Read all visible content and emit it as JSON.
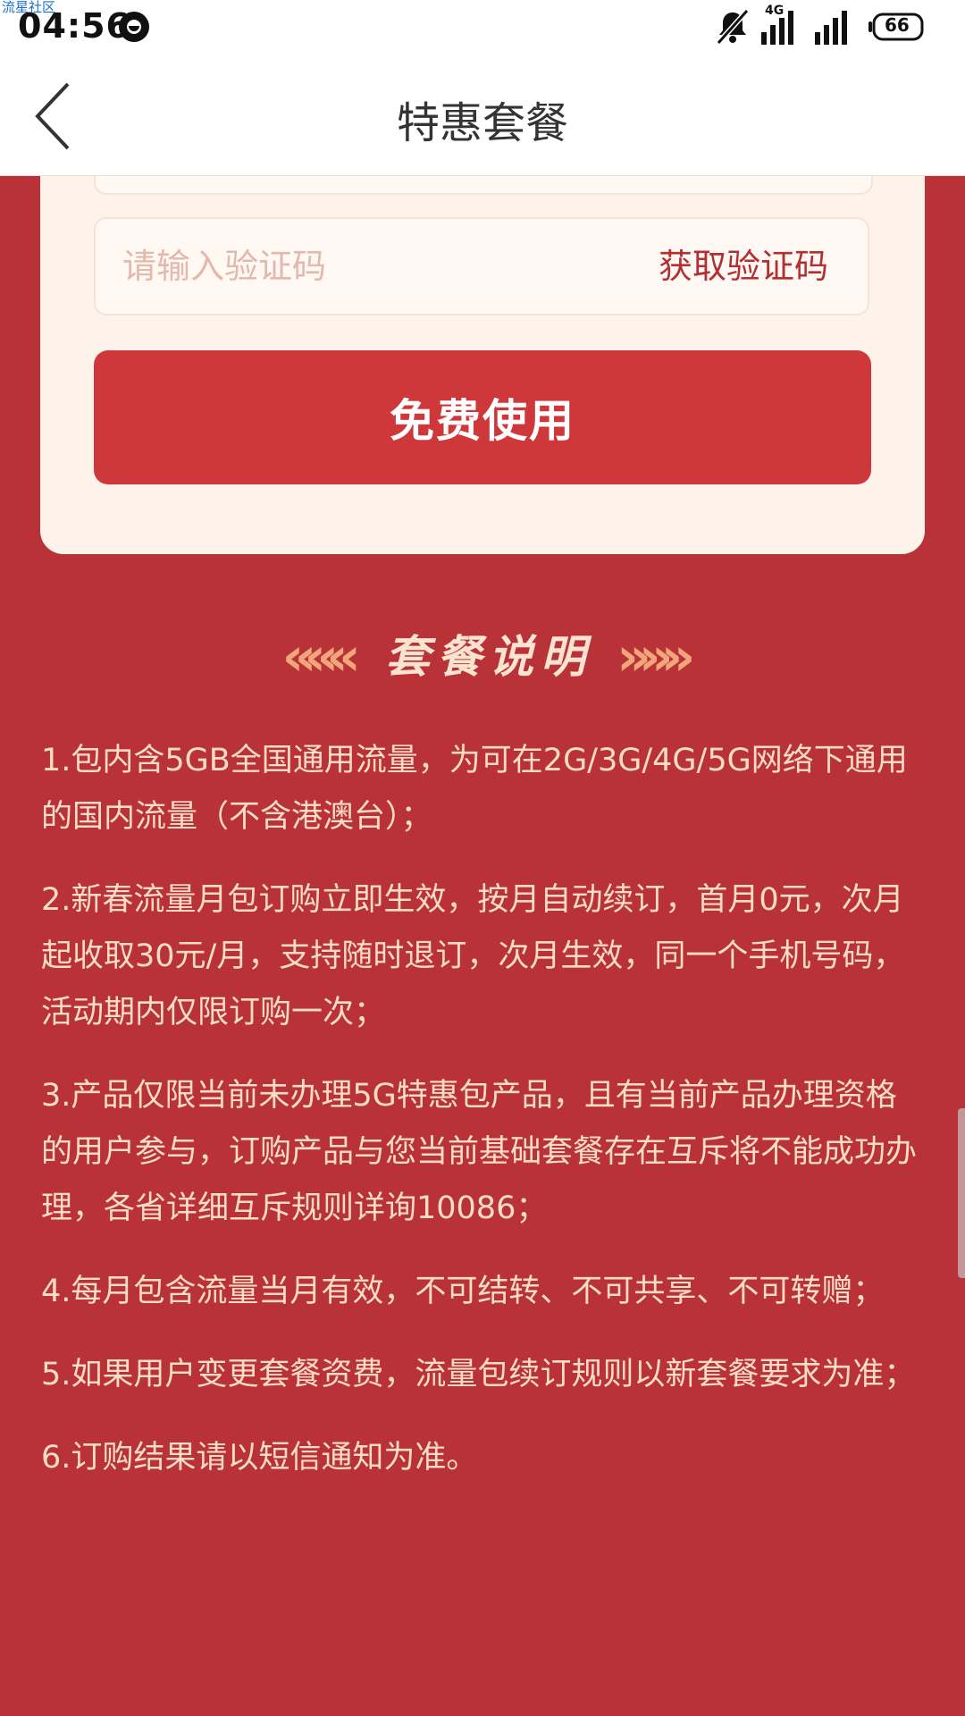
{
  "watermark": "流星社区",
  "status_bar": {
    "time": "04:56",
    "network_label": "4G",
    "battery": "66"
  },
  "header": {
    "title": "特惠套餐"
  },
  "form": {
    "code_placeholder": "请输入验证码",
    "get_code_label": "获取验证码",
    "submit_label": "免费使用"
  },
  "section": {
    "left_decor": "«««",
    "title": "套餐说明",
    "right_decor": "»»»"
  },
  "rules": [
    "1.包内含5GB全国通用流量，为可在2G/3G/4G/5G网络下通用的国内流量（不含港澳台）；",
    "2.新春流量月包订购立即生效，按月自动续订，首月0元，次月起收取30元/月，支持随时退订，次月生效，同一个手机号码，活动期内仅限订购一次；",
    "3.产品仅限当前未办理5G特惠包产品，且有当前产品办理资格的用户参与，订购产品与您当前基础套餐存在互斥将不能成功办理，各省详细互斥规则详询10086；",
    "4.每月包含流量当月有效，不可结转、不可共享、不可转赠；",
    "5.如果用户变更套餐资费，流量包续订规则以新套餐要求为准；",
    "6.订购结果请以短信通知为准。"
  ],
  "colors": {
    "background": "#b83237",
    "button": "#cf383b",
    "card": "#fdf3ea",
    "text_light": "#fbdcc6",
    "accent_text": "#b32f32"
  }
}
